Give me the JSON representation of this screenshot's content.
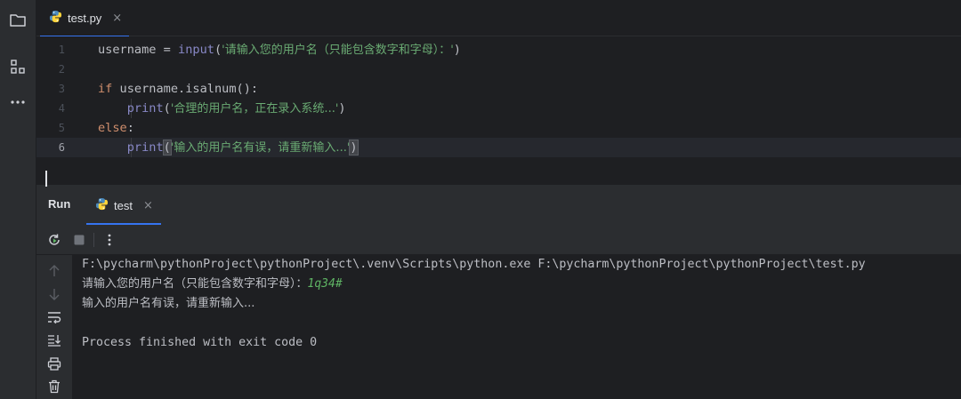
{
  "colors": {
    "background": "#1e1f22",
    "panel": "#2b2d30",
    "accent": "#3574f0",
    "keyword": "#cf8e6d",
    "builtin": "#8888c6",
    "string": "#6aab73",
    "user_input": "#5fb564"
  },
  "toolstrip": {
    "icons": [
      "folder-icon",
      "structure-icon",
      "more-icon"
    ]
  },
  "editor": {
    "tab": {
      "label": "test.py",
      "icon": "python-icon",
      "close": "×"
    },
    "current_line": 6,
    "lines": [
      {
        "number": "1",
        "tokens": [
          "username = ",
          "input",
          "(",
          "'请输入您的用户名（只能包含数字和字母）：'",
          ")"
        ]
      },
      {
        "number": "2",
        "tokens": []
      },
      {
        "number": "3",
        "tokens": [
          "if",
          " username.isalnum():"
        ]
      },
      {
        "number": "4",
        "tokens": [
          "    ",
          "print",
          "(",
          "'合理的用户名，正在录入系统...'",
          ")"
        ]
      },
      {
        "number": "5",
        "tokens": [
          "else",
          ":"
        ]
      },
      {
        "number": "6",
        "tokens": [
          "    ",
          "print",
          "(",
          "'输入的用户名有误，请重新输入...'",
          ")"
        ]
      }
    ]
  },
  "run": {
    "title": "Run",
    "tab": {
      "label": "test",
      "icon": "python-icon",
      "close": "×"
    },
    "toolbar_icons": [
      "rerun-icon",
      "stop-icon",
      "more-vertical-icon"
    ],
    "side_icons": [
      "scroll-up-icon",
      "scroll-down-icon",
      "soft-wrap-icon",
      "scroll-to-end-icon",
      "print-icon",
      "clear-icon"
    ],
    "console": {
      "command": "F:\\pycharm\\pythonProject\\pythonProject\\.venv\\Scripts\\python.exe F:\\pycharm\\pythonProject\\pythonProject\\test.py",
      "prompt": "请输入您的用户名（只能包含数字和字母）：",
      "user_input": "1q34#",
      "response": "输入的用户名有误，请重新输入...",
      "blank": "",
      "exit": "Process finished with exit code 0"
    }
  }
}
